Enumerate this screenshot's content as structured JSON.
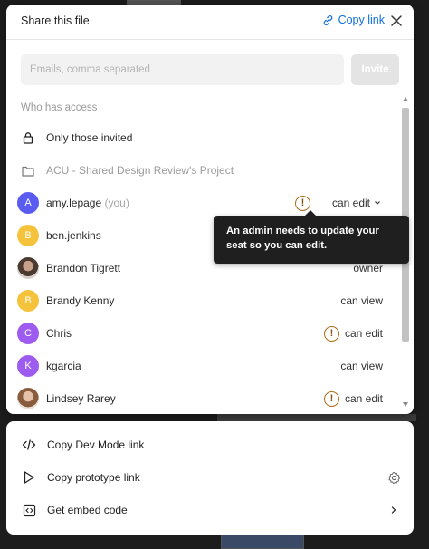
{
  "dialog": {
    "title": "Share this file",
    "copy_link_label": "Copy link",
    "invite": {
      "placeholder": "Emails, comma separated",
      "button_label": "Invite"
    },
    "access_section_label": "Who has access",
    "access_rows": [
      {
        "type": "setting",
        "icon": "lock-icon",
        "label": "Only those invited"
      },
      {
        "type": "project",
        "icon": "folder-icon",
        "label": "ACU - Shared Design Review's Project"
      }
    ],
    "members": [
      {
        "name": "amy.lepage",
        "suffix": "(you)",
        "initial": "A",
        "avatar_color": "#5a5cf0",
        "permission": "can edit",
        "warning": true,
        "dropdown": true
      },
      {
        "name": "ben.jenkins",
        "suffix": "",
        "initial": "B",
        "avatar_color": "#f5c33b",
        "permission": "",
        "warning": false,
        "dropdown": false
      },
      {
        "name": "Brandon Tigrett",
        "suffix": "",
        "initial": "",
        "avatar_color": "",
        "permission": "owner",
        "warning": false,
        "dropdown": false
      },
      {
        "name": "Brandy Kenny",
        "suffix": "",
        "initial": "B",
        "avatar_color": "#f5c33b",
        "permission": "can view",
        "warning": false,
        "dropdown": false
      },
      {
        "name": "Chris",
        "suffix": "",
        "initial": "C",
        "avatar_color": "#9d5bf0",
        "permission": "can edit",
        "warning": true,
        "dropdown": false
      },
      {
        "name": "kgarcia",
        "suffix": "",
        "initial": "K",
        "avatar_color": "#9d5bf0",
        "permission": "can view",
        "warning": false,
        "dropdown": false
      },
      {
        "name": "Lindsey Rarey",
        "suffix": "",
        "initial": "",
        "avatar_color": "",
        "permission": "can edit",
        "warning": true,
        "dropdown": false
      }
    ],
    "tooltip": "An admin needs to update your seat so you can edit."
  },
  "actions": [
    {
      "label": "Copy Dev Mode link",
      "icon": "code-icon"
    },
    {
      "label": "Copy prototype link",
      "icon": "play-icon",
      "right_icon": "gear-icon"
    },
    {
      "label": "Get embed code",
      "icon": "embed-icon",
      "right_icon": "chevron-right-icon"
    }
  ],
  "colors": {
    "link_blue": "#0d6fe0",
    "warning_amber": "#b06c18"
  }
}
